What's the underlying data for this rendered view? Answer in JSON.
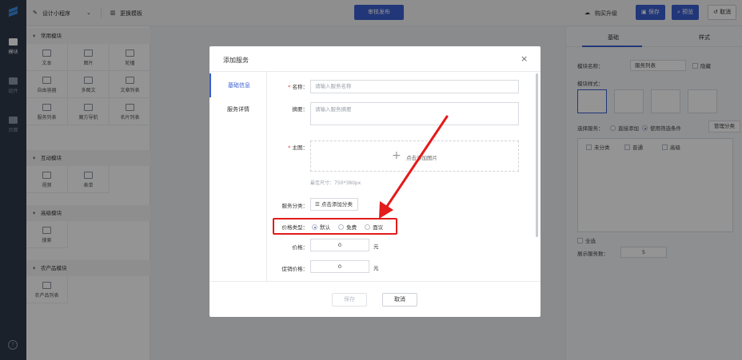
{
  "topbar": {
    "app_name": "设计小程序",
    "change_template": "更换模板",
    "review_publish": "审核发布",
    "buy_upgrade": "购买升级",
    "save": "保存",
    "preview": "预览",
    "cancel": "取消"
  },
  "leftbar": {
    "items": [
      {
        "label": "模块",
        "icon": "module-icon"
      },
      {
        "label": "组件",
        "icon": "component-icon"
      },
      {
        "label": "页面",
        "icon": "page-icon"
      }
    ]
  },
  "modules": {
    "sections": [
      {
        "title": "常用模块",
        "items": [
          "文本",
          "图片",
          "轮播",
          "自由容器",
          "多图文",
          "文章列表",
          "服务列表",
          "魔方导航",
          "名片列表"
        ]
      },
      {
        "title": "互动模块",
        "items": [
          "视频",
          "表单"
        ]
      },
      {
        "title": "高级模块",
        "items": [
          "搜索"
        ]
      },
      {
        "title": "农产品模块",
        "items": [
          "农产品列表"
        ]
      }
    ]
  },
  "right_panel": {
    "tabs": [
      "基础",
      "样式"
    ],
    "module_name_label": "模块名称：",
    "module_name_value": "服务列表",
    "hide_label": "隐藏",
    "module_style_label": "模块样式：",
    "select_service_label": "选择服务：",
    "direct_add": "直接添加",
    "use_filter": "使用筛选条件",
    "manage_category": "管理分类",
    "categories": [
      "未分类",
      "普通",
      "高级"
    ],
    "select_all": "全选",
    "display_count_label": "展示服务数：",
    "display_count_value": "5"
  },
  "modal": {
    "title": "添加服务",
    "tabs": [
      "基础信息",
      "服务详情"
    ],
    "name_label": "名称：",
    "name_placeholder": "请输入服务名称",
    "summary_label": "摘要：",
    "summary_placeholder": "请输入服务摘要",
    "cover_label": "主图：",
    "upload_text": "点击添加图片",
    "size_hint": "最佳尺寸：750*380px",
    "category_label": "服务分类：",
    "add_category": "点击添加分类",
    "price_type_label": "价格类型：",
    "price_types": [
      "默认",
      "免费",
      "面议"
    ],
    "price_type_selected": "默认",
    "price_label": "价格：",
    "price_value": "0",
    "promo_label": "促销价格：",
    "promo_value": "0",
    "unit": "元",
    "save": "保存",
    "cancel": "取消"
  },
  "colors": {
    "primary": "#3b5fd0",
    "sidebar": "#2f3a4a",
    "highlight": "#e31b1b"
  }
}
